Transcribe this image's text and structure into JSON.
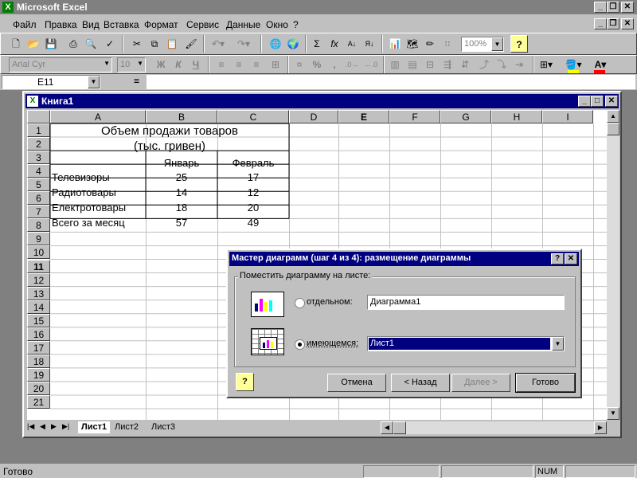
{
  "app": {
    "title": "Microsoft Excel"
  },
  "menu": {
    "items": [
      "Файл",
      "Правка",
      "Вид",
      "Вставка",
      "Формат",
      "Сервис",
      "Данные",
      "Окно",
      "?"
    ]
  },
  "toolbar": {
    "zoom": "100%"
  },
  "format_toolbar": {
    "font": "Arial Cyr",
    "size": "10",
    "bold": "Ж",
    "italic": "К",
    "underline": "Ч",
    "comma": ","
  },
  "formula_bar": {
    "cell_ref": "E11",
    "equals": "="
  },
  "workbook": {
    "title": "Книга1",
    "columns": [
      "A",
      "B",
      "C",
      "D",
      "E",
      "F",
      "G",
      "H",
      "I"
    ],
    "rows": [
      "1",
      "2",
      "3",
      "4",
      "5",
      "6",
      "7",
      "8",
      "9",
      "10",
      "11",
      "12",
      "13",
      "14",
      "15",
      "16",
      "17",
      "18",
      "19",
      "20",
      "21"
    ],
    "table": {
      "title1": "Объем продажи товаров",
      "title2": "(тыс. гривен)",
      "headers": [
        "Январь",
        "Февраль"
      ],
      "data": [
        [
          "Телевизоры",
          "25",
          "17"
        ],
        [
          "Радиотовары",
          "14",
          "12"
        ],
        [
          "Електротовары",
          "18",
          "20"
        ],
        [
          "Всего за месяц",
          "57",
          "49"
        ]
      ]
    },
    "sheets": [
      "Лист1",
      "Лист2",
      "Лист3"
    ]
  },
  "dialog": {
    "title": "Мастер диаграмм (шаг 4 из 4): размещение диаграммы",
    "group_label": "Поместить диаграмму на листе:",
    "option_separate": "отдельном:",
    "option_separate_value": "Диаграмма1",
    "option_existing": "имеющемся:",
    "option_existing_value": "Лист1",
    "buttons": {
      "cancel": "Отмена",
      "back": "< Назад",
      "next": "Далее >",
      "finish": "Готово"
    }
  },
  "status": {
    "text": "Готово",
    "num": "NUM"
  },
  "colors": {
    "title_active": "#000080",
    "grid": "#c0c0c0",
    "face": "#c0c0c0"
  }
}
